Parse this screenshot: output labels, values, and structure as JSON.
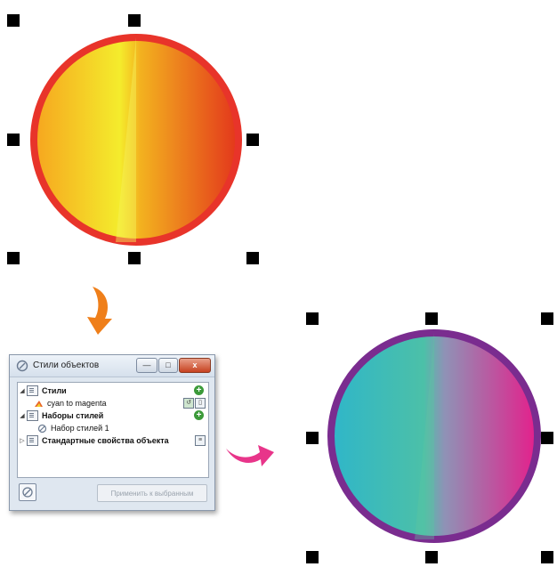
{
  "docker": {
    "title": "Стили объектов",
    "icons": [
      "style-brush-icon",
      "minimize-icon",
      "maximize-icon",
      "close-icon"
    ],
    "window_buttons": {
      "minimize": "—",
      "maximize": "□",
      "close": "x"
    },
    "tree": {
      "styles_label": "Стили",
      "style_item": "cyan to magenta",
      "style_sets_label": "Наборы стилей",
      "style_set_item": "Набор стилей 1",
      "default_props_label": "Стандартные свойства объекта"
    },
    "apply_button": "Применить к выбранным"
  },
  "colors": {
    "original_outline": "#e8342a",
    "original_fill_start": "#f5ee2a",
    "original_fill_end": "#e43c1c",
    "styled_outline": "#7a2c8f",
    "styled_fill_start": "#33b8c8",
    "styled_fill_end": "#e41f8c",
    "arrow_orange": "#ef7f1a",
    "arrow_pink": "#e8358a"
  }
}
